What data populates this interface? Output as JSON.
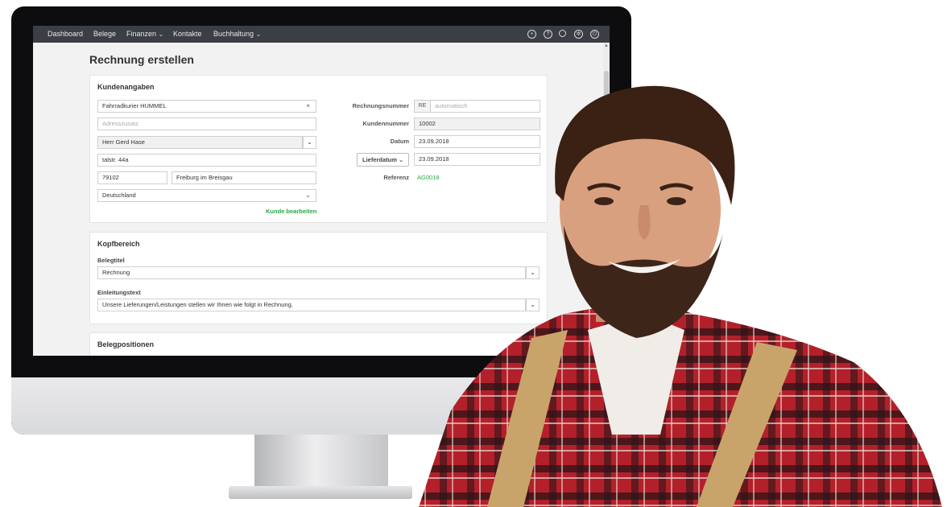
{
  "nav": {
    "items": [
      {
        "label": "Dashboard",
        "caret": ""
      },
      {
        "label": "Belege",
        "caret": ""
      },
      {
        "label": "Finanzen",
        "caret": "⌄"
      },
      {
        "label": "Kontakte",
        "caret": ""
      },
      {
        "label": "Buchhaltung",
        "caret": "⌄"
      }
    ],
    "icons": [
      "plus-circle-icon",
      "help-icon",
      "search-icon",
      "gear-icon",
      "power-icon"
    ]
  },
  "page": {
    "title": "Rechnung erstellen"
  },
  "kundenangaben": {
    "title": "Kundenangaben",
    "company": "Fahrradkurier HUMMEL",
    "address_extra_placeholder": "Adresszusatz",
    "contact": "Herr Gerd Hase",
    "street": "talstr. 44a",
    "zip": "79102",
    "city": "Freiburg im Breisgau",
    "country": "Deutschland",
    "edit_link": "Kunde bearbeiten",
    "invoice_number_label": "Rechnungsnummer",
    "invoice_prefix": "RE",
    "invoice_number_placeholder": "automatisch",
    "customer_number_label": "Kundennummer",
    "customer_number": "10002",
    "date_label": "Datum",
    "date": "23.09.2018",
    "delivery_date_button": "Lieferdatum",
    "delivery_date": "23.09.2018",
    "reference_label": "Referenz",
    "reference": "AG0018"
  },
  "kopfbereich": {
    "title": "Kopfbereich",
    "belegtitel_label": "Belegtitel",
    "belegtitel": "Rechnung",
    "einleitung_label": "Einleitungstext",
    "einleitung": "Unsere Lieferungen/Leistungen stellen wir Ihnen wie folgt in Rechnung."
  },
  "belegpositionen": {
    "title": "Belegpositionen"
  },
  "colors": {
    "nav_bg": "#3b3f45",
    "accent_green": "#28a745",
    "shirt_red": "#b3202a",
    "suspender": "#c9a46a"
  }
}
